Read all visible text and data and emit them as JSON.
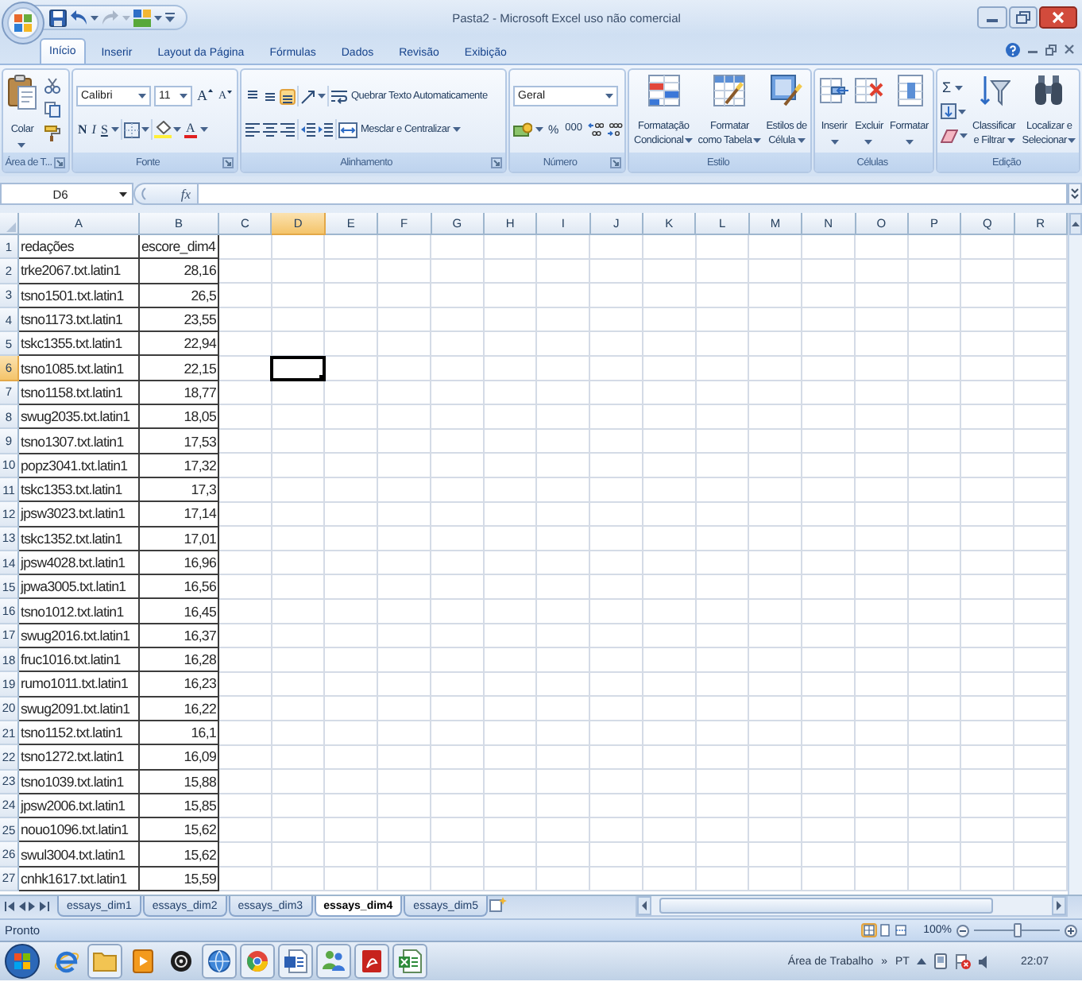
{
  "window": {
    "title": "Pasta2 - Microsoft Excel uso não comercial"
  },
  "quick_access": [
    {
      "kind": "save",
      "disabled": false
    },
    {
      "kind": "undo",
      "disabled": false
    },
    {
      "kind": "redo",
      "disabled": true
    },
    {
      "kind": "color_blocks",
      "disabled": false
    }
  ],
  "ribbon_tabs": [
    {
      "label": "Início",
      "selected": true
    },
    {
      "label": "Inserir",
      "selected": false
    },
    {
      "label": "Layout da Página",
      "selected": false
    },
    {
      "label": "Fórmulas",
      "selected": false
    },
    {
      "label": "Dados",
      "selected": false
    },
    {
      "label": "Revisão",
      "selected": false
    },
    {
      "label": "Exibição",
      "selected": false
    }
  ],
  "ribbon": {
    "clipboard": {
      "paste_label": "Colar",
      "group_label": "Área de T..."
    },
    "font": {
      "font_name": "Calibri",
      "font_size": "11",
      "grow_label": "A",
      "shrink_label": "A",
      "bold_label": "N",
      "italic_label": "I",
      "underline_label": "S",
      "font_color_label": "A",
      "group_label": "Fonte"
    },
    "alignment": {
      "vertical_buttons": [
        {
          "kind": "top",
          "selected": false
        },
        {
          "kind": "middle",
          "selected": false
        },
        {
          "kind": "bottom",
          "selected": true
        }
      ],
      "wrap_label": "Quebrar Texto Automaticamente",
      "merge_label": "Mesclar e Centralizar",
      "group_label": "Alinhamento"
    },
    "number": {
      "format": "Geral",
      "percent_label": "%",
      "thousands_label": "000",
      "group_label": "Número"
    },
    "styles": {
      "buttons": [
        {
          "kind": "conditional",
          "lines": [
            "Formatação",
            "Condicional"
          ]
        },
        {
          "kind": "table",
          "lines": [
            "Formatar",
            "como Tabela"
          ]
        },
        {
          "kind": "cell",
          "lines": [
            "Estilos de",
            "Célula"
          ]
        }
      ],
      "group_label": "Estilo"
    },
    "cells": {
      "buttons": [
        {
          "kind": "insert",
          "label": "Inserir"
        },
        {
          "kind": "delete",
          "label": "Excluir"
        },
        {
          "kind": "format",
          "label": "Formatar"
        }
      ],
      "group_label": "Células"
    },
    "editing": {
      "autosum_label": "Σ",
      "buttons": [
        {
          "kind": "sort",
          "lines": [
            "Classificar",
            "e Filtrar"
          ]
        },
        {
          "kind": "find",
          "lines": [
            "Localizar e",
            "Selecionar"
          ]
        }
      ],
      "group_label": "Edição"
    }
  },
  "formula_bar": {
    "name_box": "D6",
    "function_label": "fx"
  },
  "columns": [
    {
      "label": "A",
      "selected": false
    },
    {
      "label": "B",
      "selected": false
    },
    {
      "label": "C",
      "selected": false
    },
    {
      "label": "D",
      "selected": true
    },
    {
      "label": "E",
      "selected": false
    },
    {
      "label": "F",
      "selected": false
    },
    {
      "label": "G",
      "selected": false
    },
    {
      "label": "H",
      "selected": false
    },
    {
      "label": "I",
      "selected": false
    },
    {
      "label": "J",
      "selected": false
    },
    {
      "label": "K",
      "selected": false
    },
    {
      "label": "L",
      "selected": false
    },
    {
      "label": "M",
      "selected": false
    },
    {
      "label": "N",
      "selected": false
    },
    {
      "label": "O",
      "selected": false
    },
    {
      "label": "P",
      "selected": false
    },
    {
      "label": "Q",
      "selected": false
    },
    {
      "label": "R",
      "selected": false
    }
  ],
  "rows": [
    {
      "number": "1",
      "kind": "text",
      "selected": false,
      "cells": [
        "redações",
        "escore_dim4"
      ]
    },
    {
      "number": "2",
      "kind": "data",
      "selected": false,
      "cells": [
        "trke2067.txt.latin1",
        "28,16"
      ]
    },
    {
      "number": "3",
      "kind": "data",
      "selected": false,
      "cells": [
        "tsno1501.txt.latin1",
        "26,5"
      ]
    },
    {
      "number": "4",
      "kind": "data",
      "selected": false,
      "cells": [
        "tsno1173.txt.latin1",
        "23,55"
      ]
    },
    {
      "number": "5",
      "kind": "data",
      "selected": false,
      "cells": [
        "tskc1355.txt.latin1",
        "22,94"
      ]
    },
    {
      "number": "6",
      "kind": "data",
      "selected": true,
      "cells": [
        "tsno1085.txt.latin1",
        "22,15"
      ]
    },
    {
      "number": "7",
      "kind": "data",
      "selected": false,
      "cells": [
        "tsno1158.txt.latin1",
        "18,77"
      ]
    },
    {
      "number": "8",
      "kind": "data",
      "selected": false,
      "cells": [
        "swug2035.txt.latin1",
        "18,05"
      ]
    },
    {
      "number": "9",
      "kind": "data",
      "selected": false,
      "cells": [
        "tsno1307.txt.latin1",
        "17,53"
      ]
    },
    {
      "number": "10",
      "kind": "data",
      "selected": false,
      "cells": [
        "popz3041.txt.latin1",
        "17,32"
      ]
    },
    {
      "number": "11",
      "kind": "data",
      "selected": false,
      "cells": [
        "tskc1353.txt.latin1",
        "17,3"
      ]
    },
    {
      "number": "12",
      "kind": "data",
      "selected": false,
      "cells": [
        "jpsw3023.txt.latin1",
        "17,14"
      ]
    },
    {
      "number": "13",
      "kind": "data",
      "selected": false,
      "cells": [
        "tskc1352.txt.latin1",
        "17,01"
      ]
    },
    {
      "number": "14",
      "kind": "data",
      "selected": false,
      "cells": [
        "jpsw4028.txt.latin1",
        "16,96"
      ]
    },
    {
      "number": "15",
      "kind": "data",
      "selected": false,
      "cells": [
        "jpwa3005.txt.latin1",
        "16,56"
      ]
    },
    {
      "number": "16",
      "kind": "data",
      "selected": false,
      "cells": [
        "tsno1012.txt.latin1",
        "16,45"
      ]
    },
    {
      "number": "17",
      "kind": "data",
      "selected": false,
      "cells": [
        "swug2016.txt.latin1",
        "16,37"
      ]
    },
    {
      "number": "18",
      "kind": "data",
      "selected": false,
      "cells": [
        "fruc1016.txt.latin1",
        "16,28"
      ]
    },
    {
      "number": "19",
      "kind": "data",
      "selected": false,
      "cells": [
        "rumo1011.txt.latin1",
        "16,23"
      ]
    },
    {
      "number": "20",
      "kind": "data",
      "selected": false,
      "cells": [
        "swug2091.txt.latin1",
        "16,22"
      ]
    },
    {
      "number": "21",
      "kind": "data",
      "selected": false,
      "cells": [
        "tsno1152.txt.latin1",
        "16,1"
      ]
    },
    {
      "number": "22",
      "kind": "data",
      "selected": false,
      "cells": [
        "tsno1272.txt.latin1",
        "16,09"
      ]
    },
    {
      "number": "23",
      "kind": "data",
      "selected": false,
      "cells": [
        "tsno1039.txt.latin1",
        "15,88"
      ]
    },
    {
      "number": "24",
      "kind": "data",
      "selected": false,
      "cells": [
        "jpsw2006.txt.latin1",
        "15,85"
      ]
    },
    {
      "number": "25",
      "kind": "data",
      "selected": false,
      "cells": [
        "nouo1096.txt.latin1",
        "15,62"
      ]
    },
    {
      "number": "26",
      "kind": "data",
      "selected": false,
      "cells": [
        "swul3004.txt.latin1",
        "15,62"
      ]
    },
    {
      "number": "27",
      "kind": "data",
      "selected": false,
      "cells": [
        "cnhk1617.txt.latin1",
        "15,59"
      ]
    }
  ],
  "sheet_tabs": [
    {
      "label": "essays_dim1",
      "selected": false
    },
    {
      "label": "essays_dim2",
      "selected": false
    },
    {
      "label": "essays_dim3",
      "selected": false
    },
    {
      "label": "essays_dim4",
      "selected": true
    },
    {
      "label": "essays_dim5",
      "selected": false
    }
  ],
  "status_bar": {
    "text": "Pronto",
    "views": [
      {
        "kind": "normal",
        "selected": true
      },
      {
        "kind": "page_layout",
        "selected": false
      },
      {
        "kind": "page_break",
        "selected": false
      }
    ],
    "zoom": "100%",
    "zoom_slider": {
      "level": 0.5
    }
  },
  "taskbar": {
    "apps": [
      {
        "kind": "e_logo",
        "open": false
      },
      {
        "kind": "folder",
        "open": true
      },
      {
        "kind": "play",
        "open": false
      },
      {
        "kind": "disc",
        "open": false
      },
      {
        "kind": "globe",
        "open": true
      },
      {
        "kind": "ring",
        "open": true
      },
      {
        "kind": "document",
        "open": true
      },
      {
        "kind": "people",
        "open": true
      },
      {
        "kind": "pdf",
        "open": true
      },
      {
        "kind": "spreadsheet",
        "open": true
      }
    ],
    "desktop_label": "Área de Trabalho",
    "chevron": "»",
    "language": "PT",
    "time": "22:07"
  }
}
